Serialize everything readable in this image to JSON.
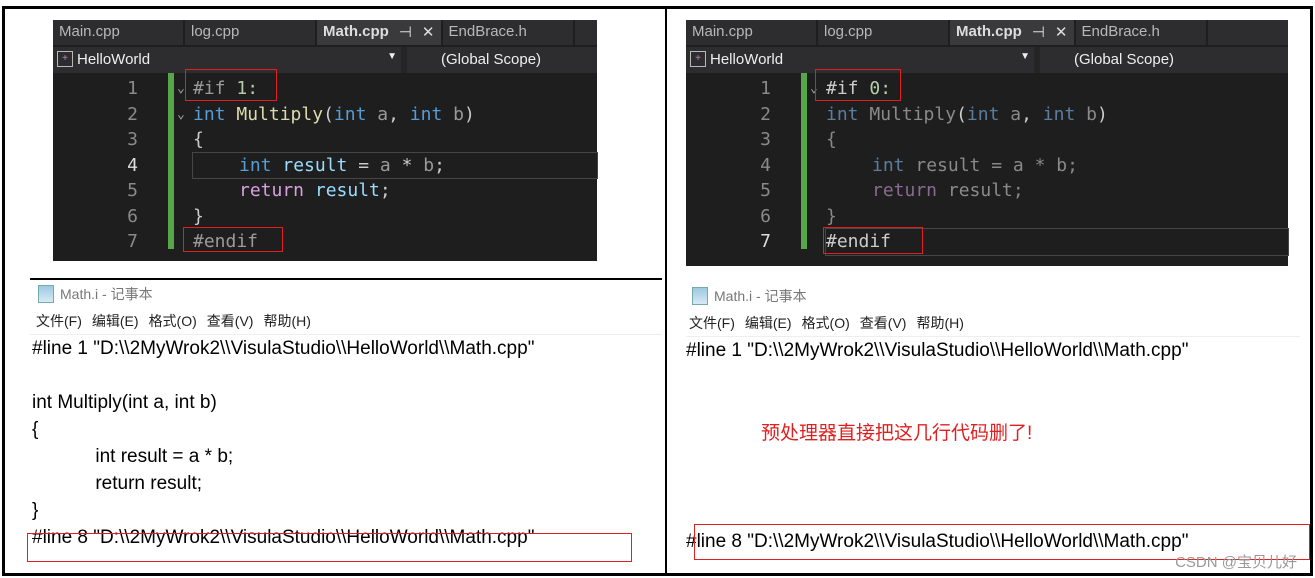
{
  "left": {
    "tabs": [
      "Main.cpp",
      "log.cpp",
      "Math.cpp",
      "EndBrace.h"
    ],
    "active_tab": "Math.cpp",
    "pin_icon": "⊣",
    "close_icon": "✕",
    "project": "HelloWorld",
    "scope": "(Global Scope)",
    "line_numbers": [
      "1",
      "2",
      "3",
      "4",
      "5",
      "6",
      "7"
    ],
    "code": {
      "if": "#if",
      "cond": "1:",
      "int": "int",
      "fn": "Multiply",
      "open": "(",
      "a": "a",
      "comma": ",",
      "b": "b",
      "close": ")",
      "lbrace": "{",
      "result": "result",
      "eq": "=",
      "expr_a": "a",
      "star": "*",
      "expr_b": "b",
      "semi": ";",
      "return": "return",
      "rbrace": "}",
      "endif": "#endif"
    },
    "notepad": {
      "title": "Math.i - 记事本",
      "menu": [
        "文件(F)",
        "编辑(E)",
        "格式(O)",
        "查看(V)",
        "帮助(H)"
      ],
      "lines": [
        "#line 1 \"D:\\\\2MyWrok2\\\\VisulaStudio\\\\HelloWorld\\\\Math.cpp\"",
        "",
        "int Multiply(int a, int b)",
        "{",
        "            int result = a * b;",
        "            return result;",
        "}",
        "#line 8 \"D:\\\\2MyWrok2\\\\VisulaStudio\\\\HelloWorld\\\\Math.cpp\""
      ]
    }
  },
  "right": {
    "tabs": [
      "Main.cpp",
      "log.cpp",
      "Math.cpp",
      "EndBrace.h"
    ],
    "project": "HelloWorld",
    "scope": "(Global Scope)",
    "line_numbers": [
      "1",
      "2",
      "3",
      "4",
      "5",
      "6",
      "7"
    ],
    "code": {
      "if": "#if",
      "cond": "0:"
    },
    "notepad": {
      "title": "Math.i - 记事本",
      "menu": [
        "文件(F)",
        "编辑(E)",
        "格式(O)",
        "查看(V)",
        "帮助(H)"
      ],
      "line1": "#line 1 \"D:\\\\2MyWrok2\\\\VisulaStudio\\\\HelloWorld\\\\Math.cpp\"",
      "line8": "#line 8 \"D:\\\\2MyWrok2\\\\VisulaStudio\\\\HelloWorld\\\\Math.cpp\"",
      "annotation": "预处理器直接把这几行代码删了!"
    }
  },
  "watermark": "CSDN @宝贝儿好"
}
